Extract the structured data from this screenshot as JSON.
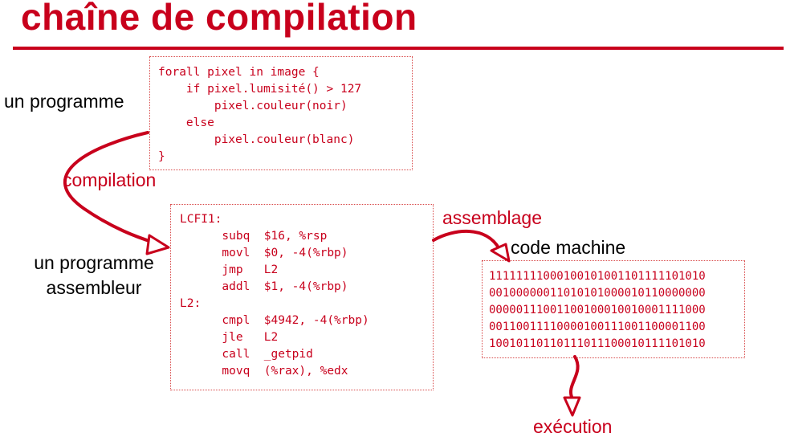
{
  "title": "chaîne de compilation",
  "labels": {
    "program": "un programme",
    "compilation": "compilation",
    "asm_program_line1": "un programme",
    "asm_program_line2": "assembleur",
    "assemblage": "assemblage",
    "machine_code": "code machine",
    "execution": "exécution"
  },
  "source_code": [
    "forall pixel in image {",
    "    if pixel.lumisité() > 127",
    "        pixel.couleur(noir)",
    "    else",
    "        pixel.couleur(blanc)",
    "}"
  ],
  "assembly_code": [
    "LCFI1:",
    "      subq  $16, %rsp",
    "      movl  $0, -4(%rbp)",
    "      jmp   L2",
    "      addl  $1, -4(%rbp)",
    "L2:",
    "      cmpl  $4942, -4(%rbp)",
    "      jle   L2",
    "      call  _getpid",
    "      movq  (%rax), %edx"
  ],
  "machine_code": [
    "11111111000100101001101111101010",
    "00100000011010101000010110000000",
    "00000111001100100010010001111000",
    "00110011110000100111001100001100",
    "10010110110111011100010111101010"
  ],
  "colors": {
    "accent": "#c8001c",
    "text": "#000000",
    "box_border": "#d84a4a"
  }
}
